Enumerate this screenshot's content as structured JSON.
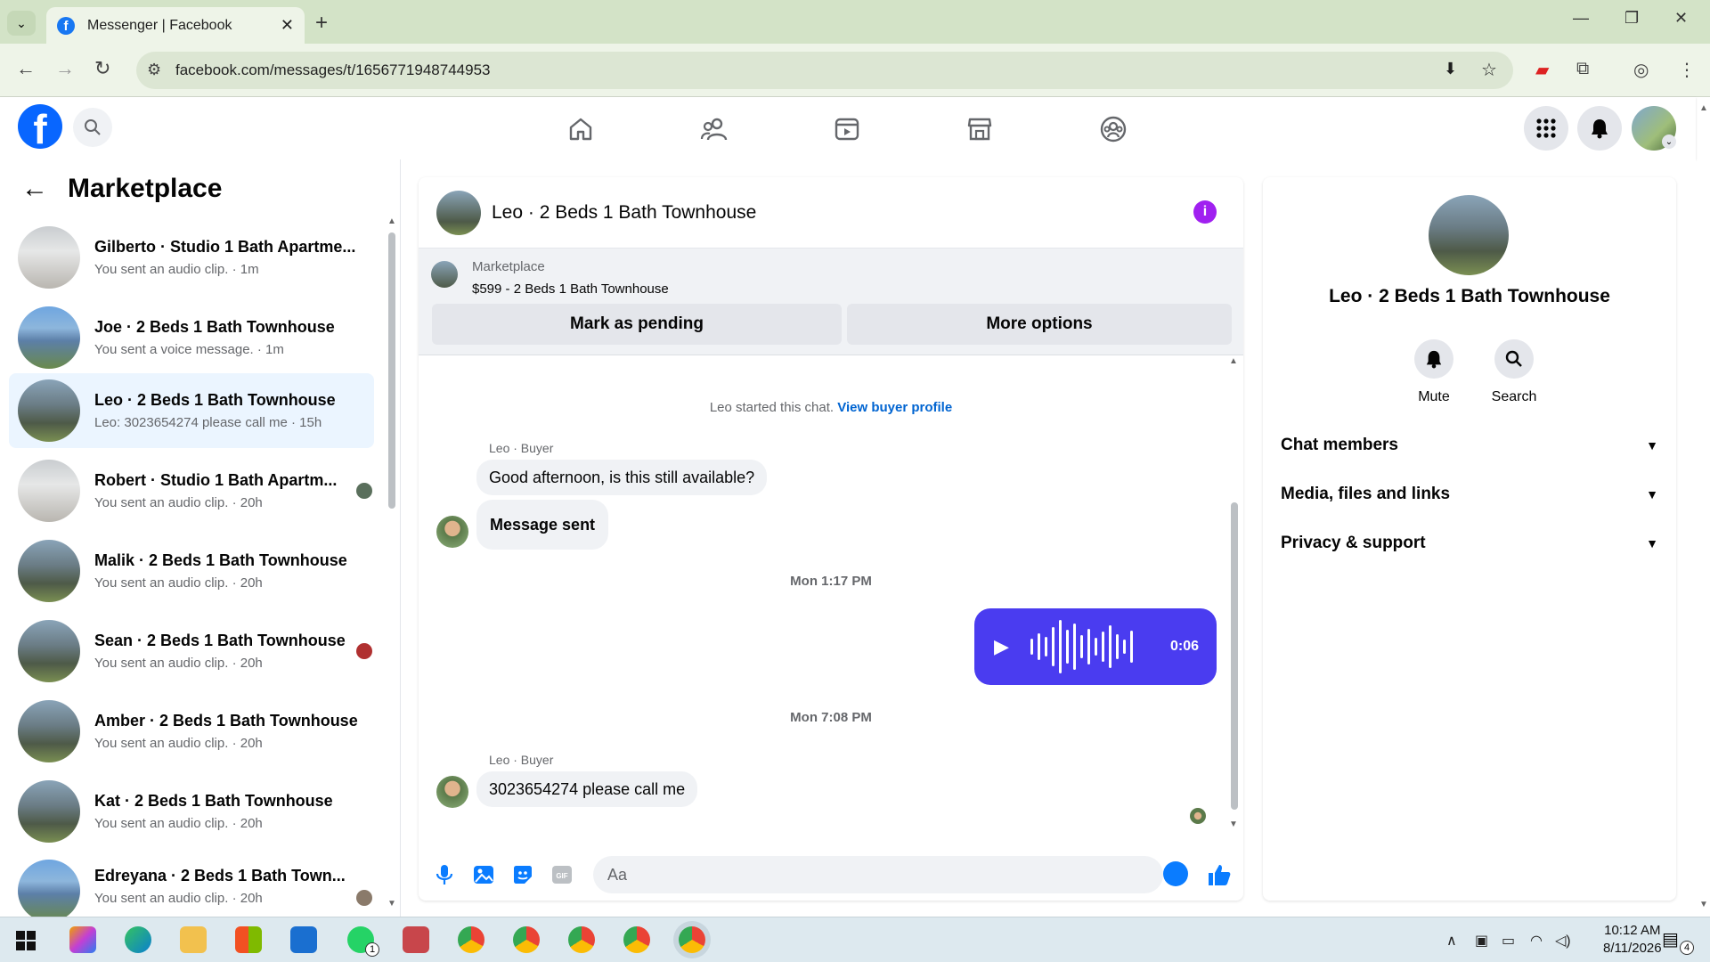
{
  "browser": {
    "tab_title": "Messenger | Facebook",
    "url": "facebook.com/messages/t/1656771948744953"
  },
  "left": {
    "header": "Marketplace",
    "conversations": [
      {
        "name": "Gilberto · Studio 1 Bath Apartme...",
        "sub": "You sent an audio clip. · 1m"
      },
      {
        "name": "Joe · 2 Beds 1 Bath Townhouse",
        "sub": "You sent a voice message. · 1m"
      },
      {
        "name": "Leo · 2 Beds 1 Bath Townhouse",
        "sub": "Leo: 3023654274 please call me · 15h"
      },
      {
        "name": "Robert · Studio 1 Bath Apartm...",
        "sub": "You sent an audio clip. · 20h"
      },
      {
        "name": "Malik · 2 Beds 1 Bath Townhouse",
        "sub": "You sent an audio clip. · 20h"
      },
      {
        "name": "Sean · 2 Beds 1 Bath Townhouse",
        "sub": "You sent an audio clip. · 20h"
      },
      {
        "name": "Amber · 2 Beds 1 Bath Townhouse",
        "sub": "You sent an audio clip. · 20h"
      },
      {
        "name": "Kat · 2 Beds 1 Bath Townhouse",
        "sub": "You sent an audio clip. · 20h"
      },
      {
        "name": "Edreyana · 2 Beds 1 Bath Town...",
        "sub": "You sent an audio clip. · 20h"
      }
    ]
  },
  "chat": {
    "title": "Leo · 2 Beds 1 Bath Townhouse",
    "marketplace_label": "Marketplace",
    "listing": "$599 - 2 Beds 1 Bath Townhouse",
    "mark_pending": "Mark as pending",
    "more_options": "More options",
    "started_text": "Leo started this chat.",
    "view_profile": "View buyer profile",
    "sender_label": "Leo · Buyer",
    "msg1": "Good afternoon, is this still available?",
    "msg2": "Message sent",
    "time1": "Mon 1:17 PM",
    "audio_duration": "0:06",
    "time2": "Mon 7:08 PM",
    "msg3": "3023654274 please call me",
    "composer_placeholder": "Aa"
  },
  "right": {
    "name": "Leo · 2 Beds 1 Bath Townhouse",
    "mute": "Mute",
    "search": "Search",
    "sections": [
      "Chat members",
      "Media, files and links",
      "Privacy & support"
    ]
  },
  "taskbar": {
    "time": "10:12 AM",
    "date": "8/11/2026",
    "notif_count": "4",
    "whatsapp_badge": "1"
  },
  "colors": {
    "fb_blue": "#0866ff",
    "audio_bubble": "#4a3cf0",
    "active_row": "#ebf5ff",
    "info": "#a020f0"
  }
}
